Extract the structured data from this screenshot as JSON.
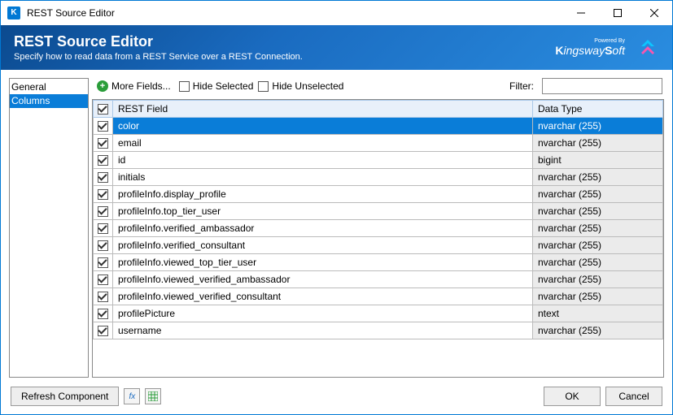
{
  "window": {
    "title": "REST Source Editor"
  },
  "header": {
    "title": "REST Source Editor",
    "subtitle": "Specify how to read data from a REST Service over a REST Connection."
  },
  "sidebar": {
    "items": [
      {
        "label": "General",
        "active": false
      },
      {
        "label": "Columns",
        "active": true
      }
    ]
  },
  "toolbar": {
    "more_fields": "More Fields...",
    "hide_selected": "Hide Selected",
    "hide_unselected": "Hide Unselected",
    "filter_label": "Filter:",
    "filter_value": ""
  },
  "table": {
    "headers": {
      "field": "REST Field",
      "datatype": "Data Type"
    },
    "rows": [
      {
        "checked": true,
        "field": "color",
        "datatype": "nvarchar (255)",
        "selected": true
      },
      {
        "checked": true,
        "field": "email",
        "datatype": "nvarchar (255)",
        "selected": false
      },
      {
        "checked": true,
        "field": "id",
        "datatype": "bigint",
        "selected": false
      },
      {
        "checked": true,
        "field": "initials",
        "datatype": "nvarchar (255)",
        "selected": false
      },
      {
        "checked": true,
        "field": "profileInfo.display_profile",
        "datatype": "nvarchar (255)",
        "selected": false
      },
      {
        "checked": true,
        "field": "profileInfo.top_tier_user",
        "datatype": "nvarchar (255)",
        "selected": false
      },
      {
        "checked": true,
        "field": "profileInfo.verified_ambassador",
        "datatype": "nvarchar (255)",
        "selected": false
      },
      {
        "checked": true,
        "field": "profileInfo.verified_consultant",
        "datatype": "nvarchar (255)",
        "selected": false
      },
      {
        "checked": true,
        "field": "profileInfo.viewed_top_tier_user",
        "datatype": "nvarchar (255)",
        "selected": false
      },
      {
        "checked": true,
        "field": "profileInfo.viewed_verified_ambassador",
        "datatype": "nvarchar (255)",
        "selected": false
      },
      {
        "checked": true,
        "field": "profileInfo.viewed_verified_consultant",
        "datatype": "nvarchar (255)",
        "selected": false
      },
      {
        "checked": true,
        "field": "profilePicture",
        "datatype": "ntext",
        "selected": false
      },
      {
        "checked": true,
        "field": "username",
        "datatype": "nvarchar (255)",
        "selected": false
      }
    ]
  },
  "footer": {
    "refresh": "Refresh Component",
    "ok": "OK",
    "cancel": "Cancel"
  },
  "logos": {
    "powered_by": "Powered By",
    "kingsway": "KingswaySoft"
  }
}
